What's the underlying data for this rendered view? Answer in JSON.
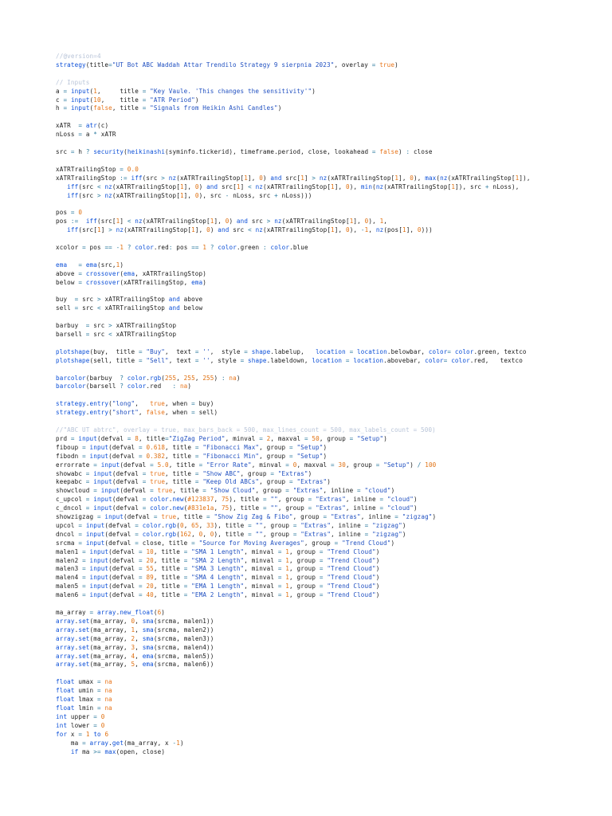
{
  "document": {
    "lines": [
      "//@version=4",
      "strategy(title=\"UT Bot ABC Waddah Attar Trendilo Strategy 9 sierpnia 2023\", overlay = true)",
      "",
      "// Inputs",
      "a = input(1,     title = \"Key Vaule. 'This changes the sensitivity'\")",
      "c = input(10,    title = \"ATR Period\")",
      "h = input(false, title = \"Signals from Heikin Ashi Candles\")",
      "",
      "xATR  = atr(c)",
      "nLoss = a * xATR",
      "",
      "src = h ? security(heikinashi(syminfo.tickerid), timeframe.period, close, lookahead = false) : close",
      "",
      "xATRTrailingStop = 0.0",
      "xATRTrailingStop := iff(src > nz(xATRTrailingStop[1], 0) and src[1] > nz(xATRTrailingStop[1], 0), max(nz(xATRTrailingStop[1]),",
      "   iff(src < nz(xATRTrailingStop[1], 0) and src[1] < nz(xATRTrailingStop[1], 0), min(nz(xATRTrailingStop[1]), src + nLoss),",
      "   iff(src > nz(xATRTrailingStop[1], 0), src - nLoss, src + nLoss)))",
      "",
      "pos = 0",
      "pos :=  iff(src[1] < nz(xATRTrailingStop[1], 0) and src > nz(xATRTrailingStop[1], 0), 1,",
      "   iff(src[1] > nz(xATRTrailingStop[1], 0) and src < nz(xATRTrailingStop[1], 0), -1, nz(pos[1], 0)))",
      "",
      "xcolor = pos == -1 ? color.red: pos == 1 ? color.green : color.blue",
      "",
      "ema   = ema(src,1)",
      "above = crossover(ema, xATRTrailingStop)",
      "below = crossover(xATRTrailingStop, ema)",
      "",
      "buy  = src > xATRTrailingStop and above",
      "sell = src < xATRTrailingStop and below",
      "",
      "barbuy  = src > xATRTrailingStop",
      "barsell = src < xATRTrailingStop",
      "",
      "plotshape(buy,  title = \"Buy\",  text = '',  style = shape.labelup,   location = location.belowbar, color= color.green, textco",
      "plotshape(sell, title = \"Sell\", text = '', style = shape.labeldown, location = location.abovebar, color= color.red,   textco",
      "",
      "barcolor(barbuy  ? color.rgb(255, 255, 255) : na)",
      "barcolor(barsell ? color.red   : na)",
      "",
      "strategy.entry(\"long\",   true, when = buy)",
      "strategy.entry(\"short\", false, when = sell)",
      "",
      "//\"ABC UT abtrc\", overlay = true, max_bars_back = 500, max_lines_count = 500, max_labels_count = 500)",
      "prd = input(defval = 8, title=\"ZigZag Period\", minval = 2, maxval = 50, group = \"Setup\")",
      "fiboup = input(defval = 0.618, title = \"Fibonacci Max\", group = \"Setup\")",
      "fibodn = input(defval = 0.382, title = \"Fibonacci Min\", group = \"Setup\")",
      "errorrate = input(defval = 5.0, title = \"Error Rate\", minval = 0, maxval = 30, group = \"Setup\") / 100",
      "showabc = input(defval = true, title = \"Show ABC\", group = \"Extras\")",
      "keepabc = input(defval = true, title = \"Keep Old ABCs\", group = \"Extras\")",
      "showcloud = input(defval = true, title = \"Show Cloud\", group = \"Extras\", inline = \"cloud\")",
      "c_upcol = input(defval = color.new(#123837, 75), title = \"\", group = \"Extras\", inline = \"cloud\")",
      "c_dncol = input(defval = color.new(#831e1a, 75), title = \"\", group = \"Extras\", inline = \"cloud\")",
      "showzigzag = input(defval = true, title = \"Show Zig Zag & Fibo\", group = \"Extras\", inline = \"zigzag\")",
      "upcol = input(defval = color.rgb(0, 65, 33), title = \"\", group = \"Extras\", inline = \"zigzag\")",
      "dncol = input(defval = color.rgb(162, 0, 0), title = \"\", group = \"Extras\", inline = \"zigzag\")",
      "srcma = input(defval = close, title = \"Source for Moving Averages\", group = \"Trend Cloud\")",
      "malen1 = input(defval = 10, title = \"SMA 1 Length\", minval = 1, group = \"Trend Cloud\")",
      "malen2 = input(defval = 20, title = \"SMA 2 Length\", minval = 1, group = \"Trend Cloud\")",
      "malen3 = input(defval = 55, title = \"SMA 3 Length\", minval = 1, group = \"Trend Cloud\")",
      "malen4 = input(defval = 89, title = \"SMA 4 Length\", minval = 1, group = \"Trend Cloud\")",
      "malen5 = input(defval = 20, title = \"EMA 1 Length\", minval = 1, group = \"Trend Cloud\")",
      "malen6 = input(defval = 40, title = \"EMA 2 Length\", minval = 1, group = \"Trend Cloud\")",
      "",
      "ma_array = array.new_float(6)",
      "array.set(ma_array, 0, sma(srcma, malen1))",
      "array.set(ma_array, 1, sma(srcma, malen2))",
      "array.set(ma_array, 2, sma(srcma, malen3))",
      "array.set(ma_array, 3, sma(srcma, malen4))",
      "array.set(ma_array, 4, ema(srcma, malen5))",
      "array.set(ma_array, 5, ema(srcma, malen6))",
      "",
      "float umax = na",
      "float umin = na",
      "float lmax = na",
      "float lmin = na",
      "int upper = 0",
      "int lower = 0",
      "for x = 1 to 6",
      "    ma = array.get(ma_array, x -1)",
      "    if ma >= max(open, close)"
    ]
  },
  "colors": {
    "background": "#ffffff",
    "keyword": "#0b4fd8",
    "string": "#1f4fc0",
    "number": "#e07010",
    "comment": "#b8c4d8"
  }
}
